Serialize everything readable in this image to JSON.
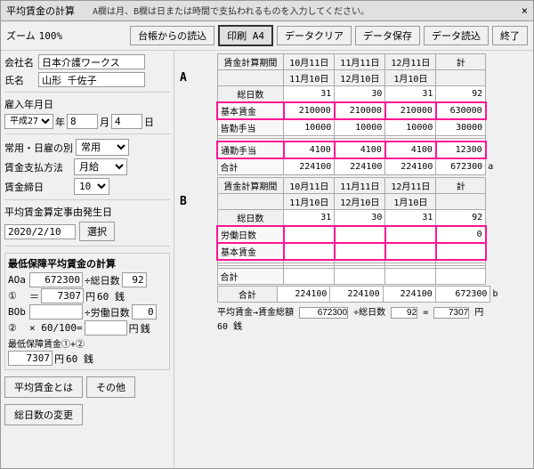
{
  "window": {
    "title": "平均賃金の計算",
    "subtitle": "A欄は月、B欄は日または時間で支払われるものを入力してください。",
    "close_label": "×"
  },
  "toolbar": {
    "zoom_label": "ズーム",
    "zoom_value": "100%",
    "btn_ledger": "台帳からの読込",
    "btn_print": "印刷 A4",
    "btn_clear": "データクリア",
    "btn_save": "データ保存",
    "btn_load": "データ読込",
    "btn_end": "終了"
  },
  "form": {
    "company_label": "会社名",
    "company_value": "日本介護ワークス",
    "name_label": "氏名",
    "name_value": "山形 千佐子",
    "birth_label": "雇入年月日",
    "birth_era": "平成27",
    "birth_year_label": "年",
    "birth_month": "8",
    "birth_month_label": "月",
    "birth_day": "4",
    "birth_day_label": "日",
    "type_label": "常用・日雇の別",
    "type_value": "常用",
    "pay_label": "賃金支払方法",
    "pay_value": "月給",
    "closing_label": "賃金締日",
    "closing_value": "10",
    "event_label": "平均賃金算定事由発生日",
    "event_date": "2020/2/10",
    "select_btn": "選択"
  },
  "calc_section": {
    "title": "最低保障平均賃金の計算",
    "aoa_label": "AOa",
    "aoa_value": "672300",
    "div_label": "÷総日数",
    "total_days": "92",
    "eq1_value": "7307",
    "yen1": "円",
    "sen1": "60 銭",
    "bob_label": "BOb",
    "div2_label": "÷労働日数",
    "labor_days": "0",
    "eq2_label": "",
    "x_label": "× 60/100=",
    "eq2_value": "",
    "yen2": "円",
    "sen2": "銭",
    "min_label": "最低保障賃金①+②",
    "min_value": "7307",
    "yen3": "円",
    "sen3": "60 銭",
    "heikin_btn": "平均賃金とは",
    "sonota_btn": "その他",
    "total_change_btn": "総日数の変更"
  },
  "table_a": {
    "section_label": "A",
    "period_label": "賃金計算期間",
    "periods": [
      "10月11日\n11月10日",
      "11月11日\n12月10日",
      "12月11日\n1月10日"
    ],
    "sum_label": "計",
    "total_days_label": "総日数",
    "total_days_values": [
      "31",
      "30",
      "31",
      "92"
    ],
    "rows": [
      {
        "label": "基本賃金",
        "values": [
          "210000",
          "210000",
          "210000",
          "630000"
        ],
        "highlight": true
      },
      {
        "label": "皆勤手当",
        "values": [
          "10000",
          "10000",
          "10000",
          "30000"
        ],
        "highlight": false
      },
      {
        "label": "",
        "values": [
          "",
          "",
          "",
          ""
        ],
        "highlight": false
      },
      {
        "label": "",
        "values": [
          "",
          "",
          "",
          ""
        ],
        "highlight": false
      },
      {
        "label": "通勤手当",
        "values": [
          "4100",
          "4100",
          "4100",
          "12300"
        ],
        "highlight": false
      },
      {
        "label": "合計",
        "values": [
          "224100",
          "224100",
          "224100",
          "672300"
        ],
        "highlight": false
      }
    ]
  },
  "table_b": {
    "section_label": "B",
    "period_label": "賃金計算期間",
    "periods": [
      "10月11日\n11月10日",
      "11月11日\n12月10日",
      "12月11日\n1月10日"
    ],
    "sum_label": "計",
    "total_days_label": "総日数",
    "total_days_values": [
      "31",
      "30",
      "31",
      "92"
    ],
    "rows": [
      {
        "label": "労働日数",
        "values": [
          "",
          "",
          "",
          "0"
        ],
        "highlight": true
      },
      {
        "label": "基本賃金",
        "values": [
          "",
          "",
          "",
          ""
        ],
        "highlight": false
      },
      {
        "label": "",
        "values": [
          "",
          "",
          "",
          ""
        ],
        "highlight": false
      },
      {
        "label": "",
        "values": [
          "",
          "",
          "",
          ""
        ],
        "highlight": false
      },
      {
        "label": "",
        "values": [
          "",
          "",
          "",
          ""
        ],
        "highlight": false
      },
      {
        "label": "合計",
        "values": [
          "",
          "",
          "",
          ""
        ],
        "highlight": false
      }
    ]
  },
  "footer": {
    "total_label": "合計",
    "total_values": [
      "224100",
      "224100",
      "224100",
      "672300"
    ],
    "formula_label": "平均賃金→賃金総額",
    "formula_total": "672300",
    "div_label": "÷総日数",
    "div_value": "92",
    "result": "7307",
    "yen": "円",
    "sen": "60 銭",
    "small_a": "a",
    "small_b": "b"
  }
}
